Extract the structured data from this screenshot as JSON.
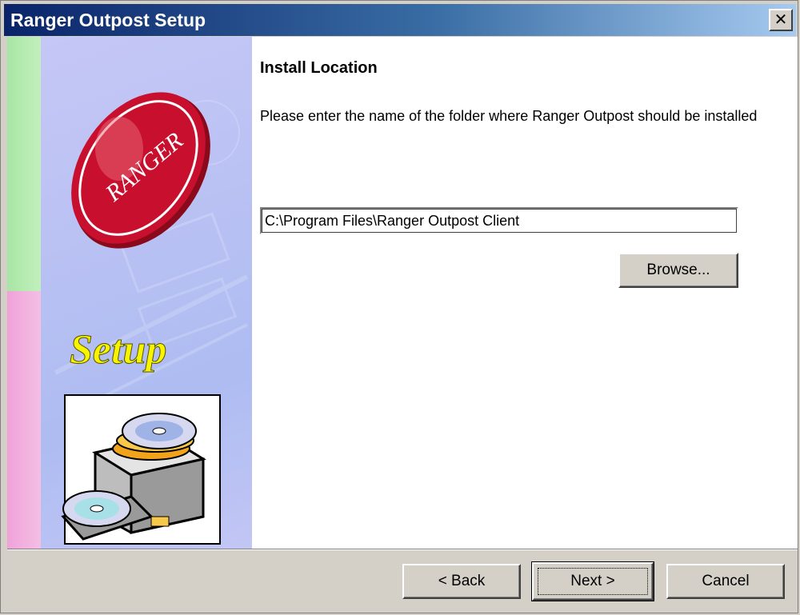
{
  "window": {
    "title": "Ranger Outpost Setup",
    "close_glyph": "✕"
  },
  "sidebar": {
    "logo_text": "RANGER",
    "setup_text": "Setup",
    "illustration_icon": "cd-drive-icon"
  },
  "page": {
    "heading": "Install Location",
    "description": "Please enter the name of the folder where Ranger Outpost should be installed"
  },
  "install_path": {
    "value": "C:\\Program Files\\Ranger Outpost Client"
  },
  "buttons": {
    "browse": "Browse...",
    "back": "< Back",
    "next": "Next >",
    "cancel": "Cancel"
  },
  "colors": {
    "title_bar_start": "#0a246a",
    "title_bar_end": "#a6caf0",
    "dialog_face": "#d4d0c8",
    "logo_red": "#c8102e",
    "setup_yellow": "#f8f400"
  }
}
